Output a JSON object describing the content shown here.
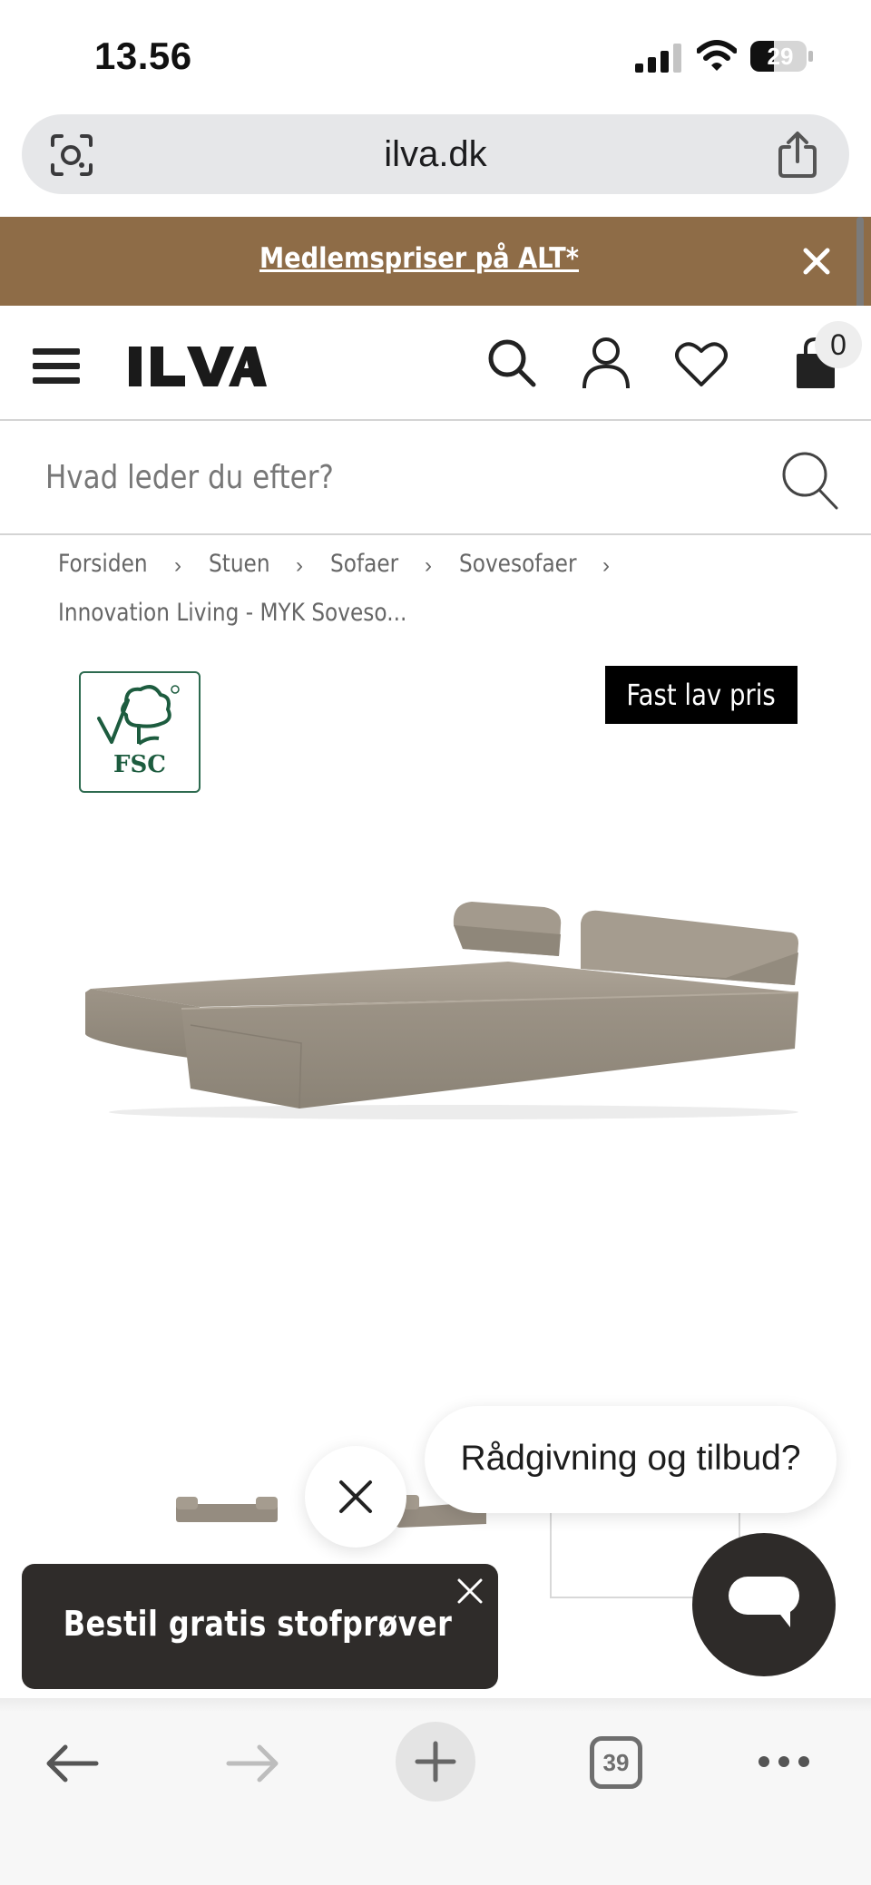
{
  "status_bar": {
    "time": "13.56",
    "battery": "29"
  },
  "url_bar": {
    "url": "ilva.dk",
    "lens_icon": "camera-search-icon",
    "share_icon": "share-icon"
  },
  "promo": {
    "text": "Medlemspriser på ALT*",
    "background": "#8e6c47"
  },
  "header": {
    "logo": "ILVA",
    "cart_count": "0"
  },
  "search": {
    "placeholder": "Hvad leder du efter?"
  },
  "breadcrumb": {
    "items": [
      "Forsiden",
      "Stuen",
      "Sofaer",
      "Sovesofaer"
    ],
    "separator": "›",
    "current": "Innovation Living - MYK Soveso..."
  },
  "product": {
    "certification": "FSC",
    "price_badge": "Fast lav pris"
  },
  "chat": {
    "bubble_text": "Rådgivning og tilbud?"
  },
  "samples_banner": {
    "text": "Bestil gratis stofprøver"
  },
  "browser_toolbar": {
    "tab_count": "39"
  }
}
